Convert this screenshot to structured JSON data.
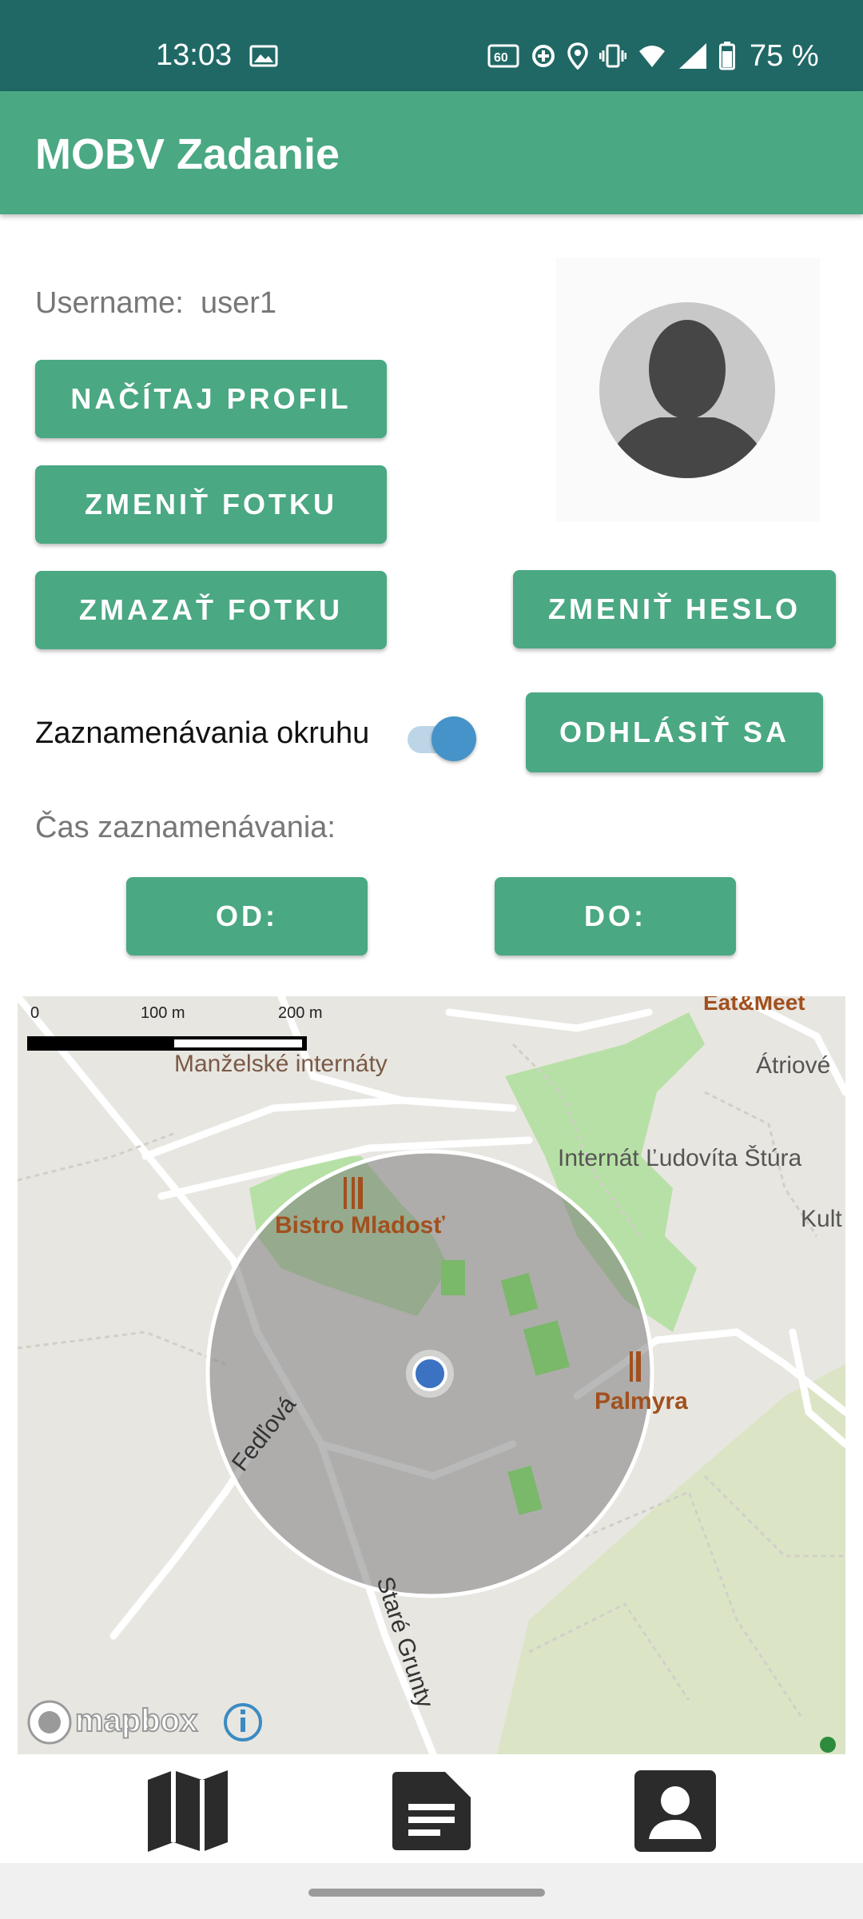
{
  "status_bar": {
    "time": "13:03",
    "battery": "75 %",
    "icons": [
      "image-icon",
      "60hz-icon",
      "data-saver-icon",
      "location-icon",
      "vibrate-icon",
      "wifi-icon",
      "signal-icon",
      "battery-icon"
    ]
  },
  "app_bar": {
    "title": "MOBV Zadanie"
  },
  "profile": {
    "username_label": "Username:",
    "username_value": "user1",
    "avatar_icon": "person-avatar-icon"
  },
  "buttons": {
    "load_profile": "NAČÍTAJ PROFIL",
    "change_photo": "ZMENIŤ FOTKU",
    "delete_photo": "ZMAZAŤ FOTKU",
    "change_password": "ZMENIŤ HESLO",
    "logout": "ODHLÁSIŤ SA",
    "from": "OD:",
    "to": "DO:"
  },
  "tracking": {
    "toggle_label": "Zaznamenávania okruhu",
    "toggle_on": true,
    "time_label": "Čas zaznamenávania:"
  },
  "map": {
    "scale": {
      "zero": "0",
      "mid": "100 m",
      "end": "200 m"
    },
    "labels": {
      "eatmeet": "Eat&Meet",
      "manzelske": "Manželské internáty",
      "atriove": "Átriové",
      "internat": "Internát Ľudovíta Štúra",
      "kult": "Kult",
      "bistro": "Bistro Mladosť",
      "palmyra": "Palmyra",
      "fedlova": "Fedľová",
      "stare": "Staré Grunty"
    },
    "attribution": "mapbox",
    "icons": [
      "fork-knife-icon",
      "info-icon",
      "mapbox-logo-icon",
      "location-dot-icon"
    ]
  },
  "bottom_nav": {
    "items": [
      "map-icon",
      "document-icon",
      "profile-icon"
    ]
  },
  "colors": {
    "status_bar": "#206866",
    "primary": "#4aa883",
    "toggle_thumb": "#4593c8",
    "poi_text": "#a1501e"
  }
}
